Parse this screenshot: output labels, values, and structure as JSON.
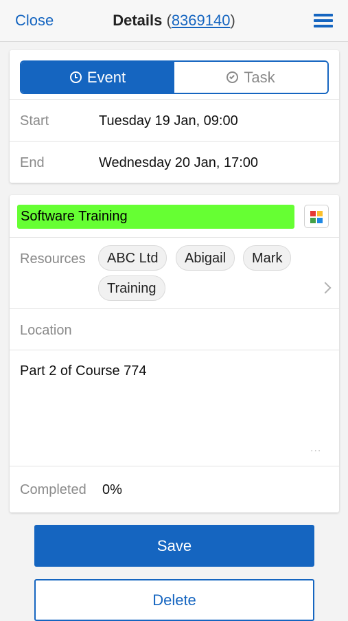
{
  "nav": {
    "close_label": "Close",
    "title": "Details",
    "paren_open": "(",
    "record_id": "8369140",
    "paren_close": ")",
    "menu_icon": "hamburger-menu-icon"
  },
  "segment": {
    "event_label": "Event",
    "event_icon": "clock-icon",
    "task_label": "Task",
    "task_icon": "check-circle-icon",
    "selected": "Event"
  },
  "schedule": {
    "start_label": "Start",
    "start_value": "Tuesday 19 Jan, 09:00",
    "end_label": "End",
    "end_value": "Wednesday 20 Jan, 17:00"
  },
  "details": {
    "title_value": "Software Training",
    "title_color": "#66ff33",
    "resources_label": "Resources",
    "resources": [
      "ABC Ltd",
      "Abigail",
      "Mark",
      "Training"
    ],
    "location_label": "Location",
    "location_value": "",
    "notes": "Part 2 of Course 774",
    "notes_handle": "...",
    "completed_label": "Completed",
    "completed_value": "0%"
  },
  "actions": {
    "save_label": "Save",
    "delete_label": "Delete"
  },
  "colors": {
    "accent": "#1565c0",
    "title_highlight": "#66ff33",
    "background": "#f3f3f3"
  }
}
